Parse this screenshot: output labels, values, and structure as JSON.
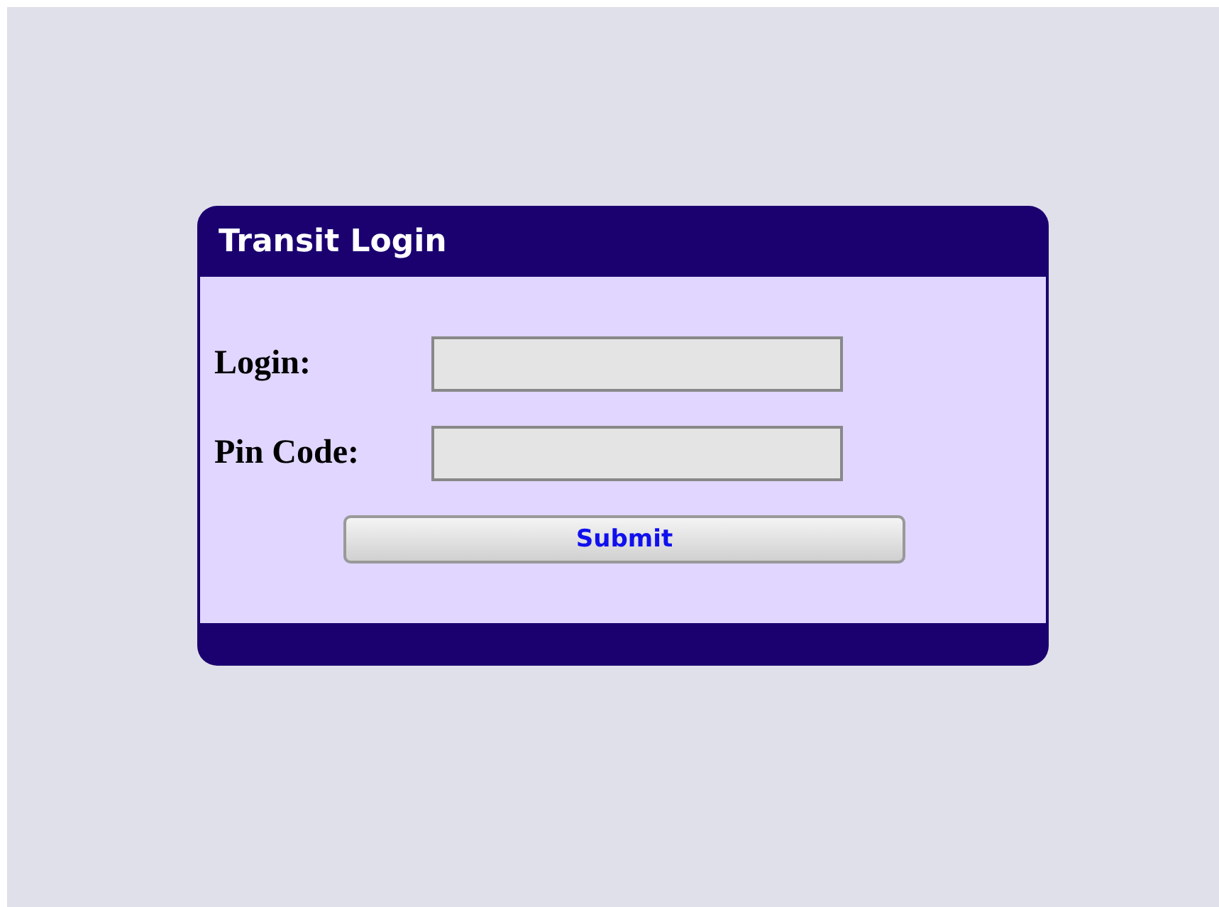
{
  "panel": {
    "title": "Transit Login"
  },
  "fields": [
    {
      "label": "Login:"
    },
    {
      "label": "Pin Code:"
    }
  ],
  "submit": {
    "label": "Submit"
  }
}
